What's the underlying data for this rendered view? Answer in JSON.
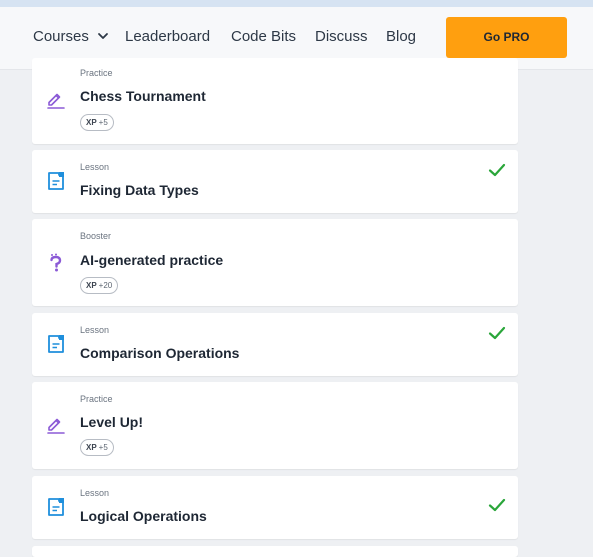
{
  "nav": {
    "courses": "Courses",
    "leaderboard": "Leaderboard",
    "code_bits": "Code Bits",
    "discuss": "Discuss",
    "blog": "Blog",
    "go_pro": "Go PRO"
  },
  "cards": [
    {
      "type": "Practice",
      "title": "Chess Tournament",
      "xp_label": "XP",
      "xp_value": "+5",
      "icon": "practice-pencil-icon",
      "completed": false
    },
    {
      "type": "Lesson",
      "title": "Fixing Data Types",
      "icon": "lesson-document-icon",
      "completed": true
    },
    {
      "type": "Booster",
      "title": "AI-generated practice",
      "xp_label": "XP",
      "xp_value": "+20",
      "icon": "booster-question-icon",
      "completed": false
    },
    {
      "type": "Lesson",
      "title": "Comparison Operations",
      "icon": "lesson-document-icon",
      "completed": true
    },
    {
      "type": "Practice",
      "title": "Level Up!",
      "xp_label": "XP",
      "xp_value": "+5",
      "icon": "practice-pencil-icon",
      "completed": false
    },
    {
      "type": "Lesson",
      "title": "Logical Operations",
      "icon": "lesson-document-icon",
      "completed": true
    }
  ],
  "colors": {
    "accent_orange": "#ff9f0f",
    "check_green": "#2aa63a",
    "lesson_blue": "#1f8fdc",
    "practice_purple": "#8b5ad6"
  }
}
